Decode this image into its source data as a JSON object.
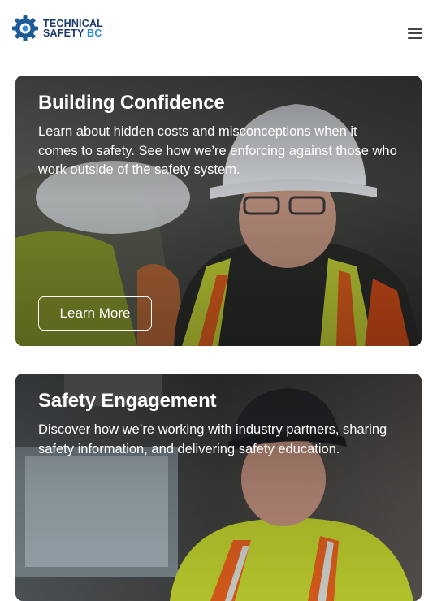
{
  "header": {
    "logo": {
      "line1": "TECHNICAL",
      "line2_a": "SAFETY",
      "line2_b": "BC",
      "icon": "gear-icon"
    },
    "menu": {
      "icon": "hamburger-menu-icon"
    }
  },
  "cards": [
    {
      "title": "Building Confidence",
      "text": "Learn about hidden costs and misconceptions when it comes to safety. See how we’re enforcing against those who work outside of the safety system.",
      "button_label": "Learn More"
    },
    {
      "title": "Safety Engagement",
      "text": "Discover how we’re working with industry partners, sharing safety information, and delivering safety education."
    }
  ],
  "colors": {
    "brand_navy": "#1d3c6b",
    "brand_blue": "#2d8bd1",
    "hardhat_white": "#e9eef2",
    "hivis_yellow": "#c9d838",
    "hivis_orange": "#e8621e"
  }
}
